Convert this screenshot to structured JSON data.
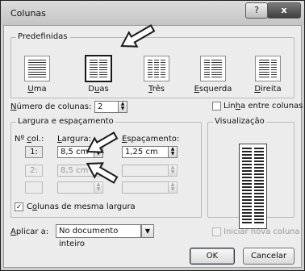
{
  "window": {
    "title": "Colunas",
    "help_glyph": "?",
    "close_glyph": "x"
  },
  "presets": {
    "label": "Predefinidas",
    "items": [
      {
        "pre": "",
        "key": "U",
        "post": "ma",
        "columns": 1
      },
      {
        "pre": "D",
        "key": "u",
        "post": "as",
        "columns": 2
      },
      {
        "pre": "",
        "key": "T",
        "post": "rês",
        "columns": 3
      },
      {
        "pre": "",
        "key": "E",
        "post": "squerda",
        "columns": 2
      },
      {
        "pre": "",
        "key": "D",
        "post": "ireita",
        "columns": 2
      }
    ]
  },
  "num_columns": {
    "label_pre": "",
    "label_key": "N",
    "label_post": "úmero de colunas:",
    "value": "2"
  },
  "line_between": {
    "pre": "Lin",
    "key": "h",
    "post": "a entre colunas",
    "checked": false
  },
  "width_spacing": {
    "label": "Largura e espaçamento",
    "col_header_pre": "Nº ",
    "col_header_key": "c",
    "col_header_post": "ol.:",
    "width_header_key": "L",
    "width_header_post": "argura:",
    "spacing_header_key": "E",
    "spacing_header_post": "spaçamento:",
    "rows": [
      {
        "col": "1:",
        "width": "8,5 cm",
        "spacing": "1,25 cm"
      },
      {
        "col": "2:",
        "width": "8,5 cm",
        "spacing": ""
      },
      {
        "col": "",
        "width": "",
        "spacing": ""
      }
    ]
  },
  "equal_width": {
    "pre": "C",
    "key": "o",
    "post": "lunas de mesma largura",
    "checked": true,
    "check_glyph": "✓"
  },
  "preview": {
    "label": "Visualização"
  },
  "apply_to": {
    "pre": "",
    "key": "A",
    "post": "plicar a:",
    "value": "No documento inteiro",
    "dropdown_glyph": "▼"
  },
  "new_column": {
    "label": "Iniciar nova coluna",
    "checked": false
  },
  "buttons": {
    "ok": "OK",
    "cancel": "Cancelar"
  },
  "spin_glyphs": {
    "up": "▲",
    "down": "▼"
  },
  "colors": {
    "annotation_arrow_fill": "#ffffff",
    "annotation_arrow_stroke": "#1a1a1a"
  }
}
